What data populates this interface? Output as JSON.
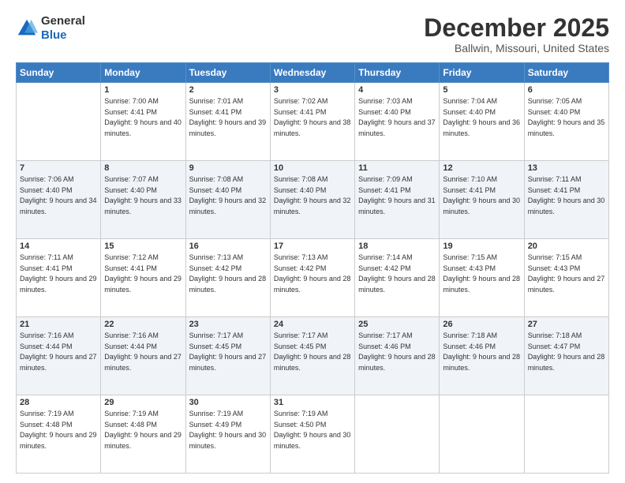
{
  "logo": {
    "general": "General",
    "blue": "Blue"
  },
  "header": {
    "month": "December 2025",
    "location": "Ballwin, Missouri, United States"
  },
  "weekdays": [
    "Sunday",
    "Monday",
    "Tuesday",
    "Wednesday",
    "Thursday",
    "Friday",
    "Saturday"
  ],
  "weeks": [
    [
      {
        "day": "",
        "sunrise": "",
        "sunset": "",
        "daylight": ""
      },
      {
        "day": "1",
        "sunrise": "Sunrise: 7:00 AM",
        "sunset": "Sunset: 4:41 PM",
        "daylight": "Daylight: 9 hours and 40 minutes."
      },
      {
        "day": "2",
        "sunrise": "Sunrise: 7:01 AM",
        "sunset": "Sunset: 4:41 PM",
        "daylight": "Daylight: 9 hours and 39 minutes."
      },
      {
        "day": "3",
        "sunrise": "Sunrise: 7:02 AM",
        "sunset": "Sunset: 4:41 PM",
        "daylight": "Daylight: 9 hours and 38 minutes."
      },
      {
        "day": "4",
        "sunrise": "Sunrise: 7:03 AM",
        "sunset": "Sunset: 4:40 PM",
        "daylight": "Daylight: 9 hours and 37 minutes."
      },
      {
        "day": "5",
        "sunrise": "Sunrise: 7:04 AM",
        "sunset": "Sunset: 4:40 PM",
        "daylight": "Daylight: 9 hours and 36 minutes."
      },
      {
        "day": "6",
        "sunrise": "Sunrise: 7:05 AM",
        "sunset": "Sunset: 4:40 PM",
        "daylight": "Daylight: 9 hours and 35 minutes."
      }
    ],
    [
      {
        "day": "7",
        "sunrise": "Sunrise: 7:06 AM",
        "sunset": "Sunset: 4:40 PM",
        "daylight": "Daylight: 9 hours and 34 minutes."
      },
      {
        "day": "8",
        "sunrise": "Sunrise: 7:07 AM",
        "sunset": "Sunset: 4:40 PM",
        "daylight": "Daylight: 9 hours and 33 minutes."
      },
      {
        "day": "9",
        "sunrise": "Sunrise: 7:08 AM",
        "sunset": "Sunset: 4:40 PM",
        "daylight": "Daylight: 9 hours and 32 minutes."
      },
      {
        "day": "10",
        "sunrise": "Sunrise: 7:08 AM",
        "sunset": "Sunset: 4:40 PM",
        "daylight": "Daylight: 9 hours and 32 minutes."
      },
      {
        "day": "11",
        "sunrise": "Sunrise: 7:09 AM",
        "sunset": "Sunset: 4:41 PM",
        "daylight": "Daylight: 9 hours and 31 minutes."
      },
      {
        "day": "12",
        "sunrise": "Sunrise: 7:10 AM",
        "sunset": "Sunset: 4:41 PM",
        "daylight": "Daylight: 9 hours and 30 minutes."
      },
      {
        "day": "13",
        "sunrise": "Sunrise: 7:11 AM",
        "sunset": "Sunset: 4:41 PM",
        "daylight": "Daylight: 9 hours and 30 minutes."
      }
    ],
    [
      {
        "day": "14",
        "sunrise": "Sunrise: 7:11 AM",
        "sunset": "Sunset: 4:41 PM",
        "daylight": "Daylight: 9 hours and 29 minutes."
      },
      {
        "day": "15",
        "sunrise": "Sunrise: 7:12 AM",
        "sunset": "Sunset: 4:41 PM",
        "daylight": "Daylight: 9 hours and 29 minutes."
      },
      {
        "day": "16",
        "sunrise": "Sunrise: 7:13 AM",
        "sunset": "Sunset: 4:42 PM",
        "daylight": "Daylight: 9 hours and 28 minutes."
      },
      {
        "day": "17",
        "sunrise": "Sunrise: 7:13 AM",
        "sunset": "Sunset: 4:42 PM",
        "daylight": "Daylight: 9 hours and 28 minutes."
      },
      {
        "day": "18",
        "sunrise": "Sunrise: 7:14 AM",
        "sunset": "Sunset: 4:42 PM",
        "daylight": "Daylight: 9 hours and 28 minutes."
      },
      {
        "day": "19",
        "sunrise": "Sunrise: 7:15 AM",
        "sunset": "Sunset: 4:43 PM",
        "daylight": "Daylight: 9 hours and 28 minutes."
      },
      {
        "day": "20",
        "sunrise": "Sunrise: 7:15 AM",
        "sunset": "Sunset: 4:43 PM",
        "daylight": "Daylight: 9 hours and 27 minutes."
      }
    ],
    [
      {
        "day": "21",
        "sunrise": "Sunrise: 7:16 AM",
        "sunset": "Sunset: 4:44 PM",
        "daylight": "Daylight: 9 hours and 27 minutes."
      },
      {
        "day": "22",
        "sunrise": "Sunrise: 7:16 AM",
        "sunset": "Sunset: 4:44 PM",
        "daylight": "Daylight: 9 hours and 27 minutes."
      },
      {
        "day": "23",
        "sunrise": "Sunrise: 7:17 AM",
        "sunset": "Sunset: 4:45 PM",
        "daylight": "Daylight: 9 hours and 27 minutes."
      },
      {
        "day": "24",
        "sunrise": "Sunrise: 7:17 AM",
        "sunset": "Sunset: 4:45 PM",
        "daylight": "Daylight: 9 hours and 28 minutes."
      },
      {
        "day": "25",
        "sunrise": "Sunrise: 7:17 AM",
        "sunset": "Sunset: 4:46 PM",
        "daylight": "Daylight: 9 hours and 28 minutes."
      },
      {
        "day": "26",
        "sunrise": "Sunrise: 7:18 AM",
        "sunset": "Sunset: 4:46 PM",
        "daylight": "Daylight: 9 hours and 28 minutes."
      },
      {
        "day": "27",
        "sunrise": "Sunrise: 7:18 AM",
        "sunset": "Sunset: 4:47 PM",
        "daylight": "Daylight: 9 hours and 28 minutes."
      }
    ],
    [
      {
        "day": "28",
        "sunrise": "Sunrise: 7:19 AM",
        "sunset": "Sunset: 4:48 PM",
        "daylight": "Daylight: 9 hours and 29 minutes."
      },
      {
        "day": "29",
        "sunrise": "Sunrise: 7:19 AM",
        "sunset": "Sunset: 4:48 PM",
        "daylight": "Daylight: 9 hours and 29 minutes."
      },
      {
        "day": "30",
        "sunrise": "Sunrise: 7:19 AM",
        "sunset": "Sunset: 4:49 PM",
        "daylight": "Daylight: 9 hours and 30 minutes."
      },
      {
        "day": "31",
        "sunrise": "Sunrise: 7:19 AM",
        "sunset": "Sunset: 4:50 PM",
        "daylight": "Daylight: 9 hours and 30 minutes."
      },
      {
        "day": "",
        "sunrise": "",
        "sunset": "",
        "daylight": ""
      },
      {
        "day": "",
        "sunrise": "",
        "sunset": "",
        "daylight": ""
      },
      {
        "day": "",
        "sunrise": "",
        "sunset": "",
        "daylight": ""
      }
    ]
  ]
}
